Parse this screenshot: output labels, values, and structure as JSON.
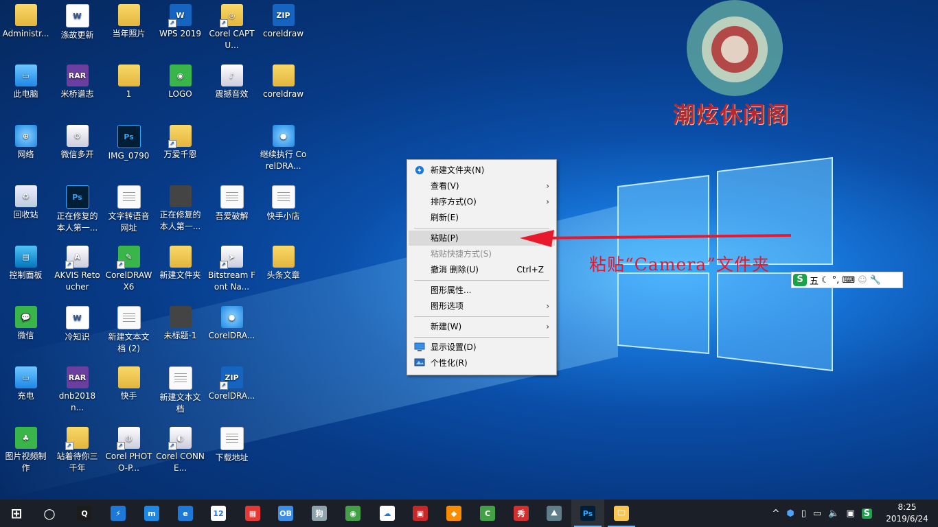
{
  "desktop": {
    "icons": [
      {
        "label": "Administr...",
        "icon": "user-folder-icon"
      },
      {
        "label": "涤故更新",
        "icon": "word-doc-icon"
      },
      {
        "label": "当年照片",
        "icon": "photo-folder-icon"
      },
      {
        "label": "WPS 2019",
        "icon": "wps-icon"
      },
      {
        "label": "Corel CAPTU...",
        "icon": "corel-capture-icon"
      },
      {
        "label": "coreldraw",
        "icon": "zip-icon"
      },
      {
        "label": "此电脑",
        "icon": "computer-icon"
      },
      {
        "label": "米桥谱志",
        "icon": "rar-icon"
      },
      {
        "label": "1",
        "icon": "folder-icon"
      },
      {
        "label": "LOGO",
        "icon": "logo-image-icon"
      },
      {
        "label": "震撼音效",
        "icon": "audio-icon"
      },
      {
        "label": "coreldraw",
        "icon": "folder-icon"
      },
      {
        "label": "网络",
        "icon": "network-icon"
      },
      {
        "label": "微信多开",
        "icon": "settings-app-icon"
      },
      {
        "label": "IMG_0790",
        "icon": "photoshop-file-icon"
      },
      {
        "label": "万爱千恩",
        "icon": "folder-icon"
      },
      {
        "label": "继续执行 CorelDRA...",
        "icon": "corel-balloon-icon"
      },
      {
        "label": "回收站",
        "icon": "recycle-bin-icon"
      },
      {
        "label": "正在修复的本人第一...",
        "icon": "photoshop-file-icon"
      },
      {
        "label": "文字转语音网址",
        "icon": "text-file-icon"
      },
      {
        "label": "正在修复的本人第一...",
        "icon": "image-file-icon"
      },
      {
        "label": "吾爱破解",
        "icon": "text-file-icon"
      },
      {
        "label": "快手小店",
        "icon": "text-file-icon"
      },
      {
        "label": "控制面板",
        "icon": "control-panel-icon"
      },
      {
        "label": "AKVIS Retoucher",
        "icon": "akvis-icon"
      },
      {
        "label": "CorelDRAW X6",
        "icon": "coreldraw-icon"
      },
      {
        "label": "新建文件夹",
        "icon": "folder-icon"
      },
      {
        "label": "Bitstream Font Na...",
        "icon": "bitstream-icon"
      },
      {
        "label": "头条文章",
        "icon": "folder-icon"
      },
      {
        "label": "微信",
        "icon": "wechat-icon"
      },
      {
        "label": "冷知识",
        "icon": "word-doc-icon"
      },
      {
        "label": "新建文本文档 (2)",
        "icon": "text-file-icon"
      },
      {
        "label": "未标题-1",
        "icon": "image-file-icon"
      },
      {
        "label": "CorelDRA...",
        "icon": "corel-balloon-icon"
      },
      {
        "label": "充电",
        "icon": "computer-icon"
      },
      {
        "label": "dnb2018n...",
        "icon": "rar-icon"
      },
      {
        "label": "快手",
        "icon": "folder-icon"
      },
      {
        "label": "新建文本文档",
        "icon": "text-file-icon"
      },
      {
        "label": "CorelDRA...",
        "icon": "zip-icon"
      },
      {
        "label": "图片视频制作",
        "icon": "tree-icon"
      },
      {
        "label": "站着待你三千年",
        "icon": "folder-icon"
      },
      {
        "label": "Corel PHOTO-P...",
        "icon": "corel-photo-paint-icon"
      },
      {
        "label": "Corel CONNE...",
        "icon": "corel-connect-icon"
      },
      {
        "label": "下载地址",
        "icon": "text-file-icon"
      }
    ],
    "watermark_text": "潮炫休闲阁"
  },
  "context_menu": {
    "items": [
      {
        "label": "新建文件夹(N)",
        "icon": "new-folder-icon",
        "state": "normal"
      },
      {
        "label": "查看(V)",
        "submenu": true,
        "state": "normal"
      },
      {
        "label": "排序方式(O)",
        "submenu": true,
        "state": "normal"
      },
      {
        "label": "刷新(E)",
        "state": "normal"
      },
      {
        "label": "粘贴(P)",
        "state": "hover"
      },
      {
        "label": "粘贴快捷方式(S)",
        "state": "disabled"
      },
      {
        "label": "撤消 删除(U)",
        "accel": "Ctrl+Z",
        "state": "normal"
      },
      {
        "label": "图形属性...",
        "state": "normal"
      },
      {
        "label": "图形选项",
        "submenu": true,
        "state": "normal"
      },
      {
        "label": "新建(W)",
        "submenu": true,
        "state": "normal"
      },
      {
        "label": "显示设置(D)",
        "icon": "display-icon",
        "state": "normal"
      },
      {
        "label": "个性化(R)",
        "icon": "personalize-icon",
        "state": "normal"
      }
    ],
    "submenu_glyph": "›"
  },
  "annotation": {
    "text": "粘贴“Camera”文件夹",
    "color": "#e8192c"
  },
  "ime_bar": {
    "logo": "S",
    "mode": "五",
    "glyphs": [
      "☾",
      "°,",
      "⌨",
      "☺",
      "🔧"
    ]
  },
  "taskbar": {
    "apps": [
      {
        "name": "start",
        "glyph": "⊞"
      },
      {
        "name": "cortana",
        "glyph": "○"
      },
      {
        "name": "qq",
        "glyph": "Q"
      },
      {
        "name": "thunder",
        "glyph": "⚡"
      },
      {
        "name": "mi-app",
        "glyph": "m"
      },
      {
        "name": "edge",
        "glyph": "e"
      },
      {
        "name": "calendar-app",
        "glyph": "12"
      },
      {
        "name": "color-app",
        "glyph": "▦"
      },
      {
        "name": "ob-app",
        "glyph": "OB"
      },
      {
        "name": "jd-app",
        "glyph": "狗"
      },
      {
        "name": "chrome",
        "glyph": "◉"
      },
      {
        "name": "baidu-netdisk",
        "glyph": "☁"
      },
      {
        "name": "video-app",
        "glyph": "▣"
      },
      {
        "name": "fish-app",
        "glyph": "◆"
      },
      {
        "name": "camtasia",
        "glyph": "C"
      },
      {
        "name": "meitu",
        "glyph": "秀"
      },
      {
        "name": "photo-viewer",
        "glyph": "⛰"
      },
      {
        "name": "photoshop",
        "glyph": "Ps"
      },
      {
        "name": "file-explorer",
        "glyph": "🗀"
      }
    ],
    "tray": {
      "glyphs": [
        "^",
        "⬢",
        "▯",
        "▭",
        "🔈",
        "▣",
        "S"
      ],
      "time": "8:25",
      "date": "2019/6/24"
    }
  },
  "colors": {
    "accent": "#76b9ed",
    "taskbar": "#1b1f27",
    "menu_bg": "#f2f2f2",
    "menu_hover": "#dadada"
  }
}
